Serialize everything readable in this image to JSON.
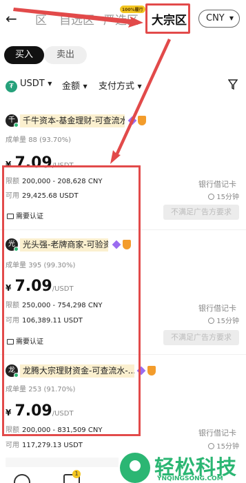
{
  "nav": {
    "back_glyph": "←",
    "tabs": [
      "区",
      "自选区",
      "严选区",
      "大宗区"
    ],
    "hot_badge": "100%履行",
    "currency": "CNY"
  },
  "trade": {
    "buy": "买入",
    "sell": "卖出"
  },
  "filters": {
    "coin": "USDT",
    "amount": "金额",
    "payment": "支付方式"
  },
  "listings": [
    {
      "avatar_char": "千",
      "merchant": "千牛资本-基金理财-可查流水",
      "deals_label": "成单量",
      "deals": "88 (93.70%)",
      "currency_symbol": "¥",
      "price": "7.09",
      "price_unit": "/USDT",
      "limit_label": "限额",
      "limit": "200,000 - 208,628 CNY",
      "available_label": "可用",
      "available": "29,425.68 USDT",
      "kyc": "需要认证",
      "payment": "银行借记卡",
      "time": "15分钟",
      "requirement": "不满足广告方要求"
    },
    {
      "avatar_char": "光",
      "merchant": "光头强-老牌商家-可验资",
      "deals_label": "成单量",
      "deals": "395 (99.30%)",
      "currency_symbol": "¥",
      "price": "7.09",
      "price_unit": "/USDT",
      "limit_label": "限额",
      "limit": "250,000 - 754,298 CNY",
      "available_label": "可用",
      "available": "106,389.11 USDT",
      "kyc": "需要认证",
      "payment": "银行借记卡",
      "time": "15分钟",
      "requirement": "不满足广告方要求"
    },
    {
      "avatar_char": "龙",
      "merchant": "龙腾大宗理财资金-可查流水-...",
      "deals_label": "成单量",
      "deals": "253 (91.70%)",
      "currency_symbol": "¥",
      "price": "7.09",
      "price_unit": "/USDT",
      "limit_label": "限额",
      "limit": "200,000 - 831,509 CNY",
      "available_label": "可用",
      "available": "117,279.13 USDT",
      "payment": "银行借记卡",
      "time": "15分钟"
    }
  ],
  "bottom": {
    "badge": "1"
  },
  "watermark": {
    "title": "轻松科技",
    "url": "YNQINGSONG.COM"
  },
  "colors": {
    "highlight": "#e24a4a",
    "brand_green": "#2bb673",
    "name_bg": "#fbf0cf"
  }
}
